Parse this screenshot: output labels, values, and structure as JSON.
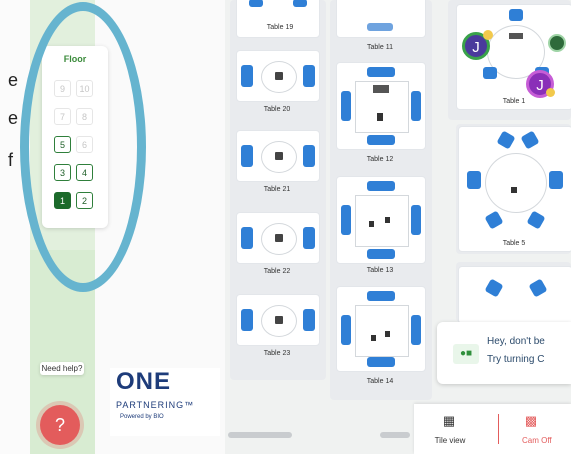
{
  "floor": {
    "title": "Floor",
    "buttons": [
      {
        "label": "9",
        "state": "dim"
      },
      {
        "label": "10",
        "state": "dim"
      },
      {
        "label": "7",
        "state": "dim"
      },
      {
        "label": "8",
        "state": "dim"
      },
      {
        "label": "5",
        "state": "on"
      },
      {
        "label": "6",
        "state": "dim"
      },
      {
        "label": "3",
        "state": "on"
      },
      {
        "label": "4",
        "state": "on"
      },
      {
        "label": "1",
        "state": "selected"
      },
      {
        "label": "2",
        "state": "on"
      }
    ]
  },
  "tables": {
    "t19": "Table 19",
    "t11": "Table 11",
    "t1": "Table 1",
    "t20": "Table 20",
    "t12": "Table 12",
    "t21": "Table 21",
    "t5": "Table 5",
    "t22": "Table 22",
    "t13": "Table 13",
    "t23": "Table 23",
    "t14": "Table 14"
  },
  "avatars": [
    {
      "initial": "J",
      "color": "#4a3a9c"
    },
    {
      "initial": "J",
      "color": "#8a2fb8"
    }
  ],
  "help": {
    "text": "Need help?",
    "button": "?"
  },
  "logo": {
    "main": "ONE",
    "sub": "PARTNERING™",
    "by": "Powered by BIO"
  },
  "toast": {
    "line1": "Hey, don't be",
    "line2": "Try turning C"
  },
  "bottombar": {
    "tile_view": "Tile view",
    "cam_off": "Cam Off"
  },
  "cutoff_text": [
    "e",
    "e",
    "f"
  ],
  "colors": {
    "accent_green": "#1c6a2b",
    "highlight_ellipse": "#66b4cf",
    "chair_blue": "#2f7fd6",
    "help_red": "#e35c5c"
  }
}
